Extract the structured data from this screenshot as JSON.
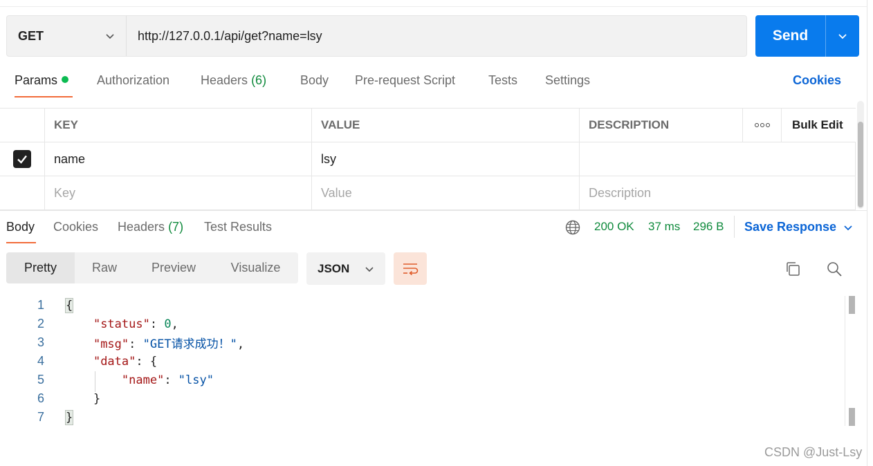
{
  "request": {
    "method": "GET",
    "url": "http://127.0.0.1/api/get?name=lsy",
    "send_label": "Send"
  },
  "request_tabs": {
    "params": "Params",
    "authorization": "Authorization",
    "headers": "Headers",
    "headers_count": "(6)",
    "body": "Body",
    "pre_request": "Pre-request Script",
    "tests": "Tests",
    "settings": "Settings",
    "cookies": "Cookies"
  },
  "params_table": {
    "headers": {
      "key": "KEY",
      "value": "VALUE",
      "description": "DESCRIPTION",
      "bulk_edit": "Bulk Edit"
    },
    "rows": [
      {
        "checked": true,
        "key": "name",
        "value": "lsy",
        "description": ""
      }
    ],
    "placeholders": {
      "key": "Key",
      "value": "Value",
      "description": "Description"
    }
  },
  "response_tabs": {
    "body": "Body",
    "cookies": "Cookies",
    "headers": "Headers",
    "headers_count": "(7)",
    "test_results": "Test Results"
  },
  "response_meta": {
    "status": "200 OK",
    "time": "37 ms",
    "size": "296 B",
    "save_label": "Save Response"
  },
  "view_modes": [
    "Pretty",
    "Raw",
    "Preview",
    "Visualize"
  ],
  "format": "JSON",
  "code_lines": {
    "n1": "1",
    "n2": "2",
    "n3": "3",
    "n4": "4",
    "n5": "5",
    "n6": "6",
    "n7": "7",
    "status_key": "\"status\"",
    "status_val": "0",
    "msg_key": "\"msg\"",
    "msg_val": "\"GET请求成功！\"",
    "data_key": "\"data\"",
    "name_key": "\"name\"",
    "name_val": "\"lsy\""
  },
  "watermark": "CSDN @Just-Lsy",
  "colors": {
    "accent_blue": "#097bed",
    "link_blue": "#0b65d6",
    "tab_active_underline": "#f26b3a",
    "status_green": "#0f8a3c"
  },
  "icons": [
    "chevron-down-icon",
    "globe-icon",
    "more-dots-icon",
    "check-icon",
    "wrap-lines-icon",
    "copy-icon",
    "search-icon"
  ]
}
